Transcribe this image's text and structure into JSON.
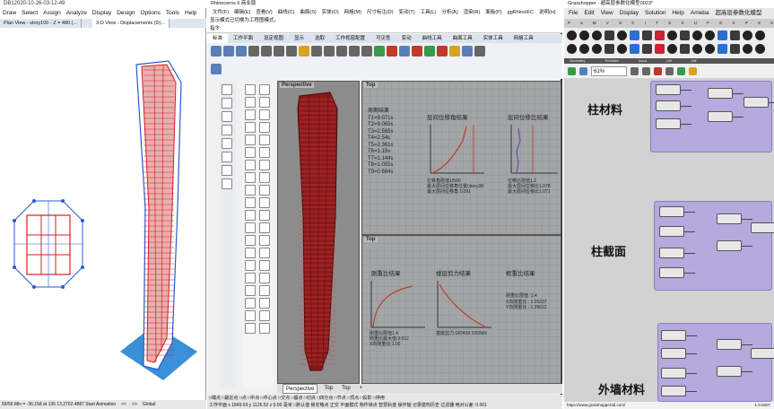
{
  "sap": {
    "title": "DB12020-10-26-03-12-49",
    "menu": [
      "Draw",
      "Select",
      "Assign",
      "Analyze",
      "Display",
      "Design",
      "Options",
      "Tools",
      "Help"
    ],
    "tab_plan": "Plan View - story100 - Z = 480 (...",
    "tab_3d": "3-D View  - Displacements (D)...",
    "status": [
      "59/56  Min = -36.158 at 136  13.2702 4887 Start Animation",
      "<<",
      ">>",
      "Global"
    ],
    "colors": {
      "frame_red": "#d62020",
      "frame_blue": "#2a5bd0",
      "base_blue": "#3a8fd6"
    }
  },
  "rhino": {
    "title": "Rhinoceros 6 商业版",
    "menu": [
      "文件(F)",
      "编辑(E)",
      "查看(V)",
      "曲线(C)",
      "曲面(S)",
      "实体(O)",
      "网格(M)",
      "尺寸标注(D)",
      "变动(T)",
      "工具(L)",
      "分析(A)",
      "渲染(R)",
      "面板(P)",
      "ggRhinoIFC",
      "说明(H)"
    ],
    "cmd_line1": "显示模式已切换为工程图模式。",
    "cmd_line2": "指令:",
    "ribbon": [
      "标准",
      "工作平面",
      "设定视图",
      "显示",
      "选取",
      "工作视窗配置",
      "可见性",
      "变动",
      "曲线工具",
      "曲面工具",
      "实体工具",
      "网格工具"
    ],
    "viewport_perspective": "Perspective",
    "viewport_top": "Top",
    "viewport_top2": "Top",
    "periods_title": "周期结果",
    "periods": [
      "T1=9.071s",
      "T2=9.065s",
      "T3=2.565s",
      "T4=2.54s",
      "T5=2.361s",
      "T6=1.15s",
      "T7=1.144s",
      "T8=1.055s",
      "T9=0.684s"
    ],
    "drift_angle_title": "层间位移角结果",
    "drift_angle_notes": [
      "位移角限值1/500",
      "最大层间位移角位置(story38",
      "最大层间位移角 1/291"
    ],
    "drift_ratio_title": "层间位移比结果",
    "drift_ratio_notes": [
      "位移比限值1.2",
      "最大层间位移比1.078",
      "最大层间位移比1.071"
    ],
    "stiffness_title": "刚重比结果",
    "stiffness_notes": [
      "刚重比限值1.4",
      "刚重比最大值:3.012",
      "X向刚重比:1.00"
    ],
    "shear_ratio_title": "楼层剪力结果",
    "shear_ratio_notes": [
      "基底剪力:182439.1003kN"
    ],
    "rigid_weight_title": "框重比结果",
    "rigid_weight_notes": [
      "刚重比限值 :1.4",
      "X向刚重比 : 1.25237",
      "Y向刚重比 : 1.35612"
    ],
    "view_tabs": [
      "Perspective",
      "Top",
      "Top",
      "+"
    ],
    "osnap": "□端点 □最近点 □点 □中点 □中心点 □交点 □垂点 □切点 □四分点 □节点 □顶点 □投影 □停用",
    "status2": "工作平面  x 1849.69  y 1125.52  z 0.00  毫米  □默认值  锁定格点  正交  平面模式  物件锁点  智慧轨迹  操作轴  记录建构历史  过滤器  绝对公差: 0.001"
  },
  "grasshopper": {
    "title": "Grasshopper - 超高层参数化模型0023*",
    "menu": [
      "File",
      "Edit",
      "View",
      "Display",
      "Solution",
      "Help",
      "Ameba",
      "超高层参数化模型"
    ],
    "tabrow": "P a M V S C I T S X U F E X P X K R E",
    "categories": [
      "Geometry",
      "Primitive",
      "Input",
      "Util",
      "Util"
    ],
    "zoom": "61%",
    "group_labels": [
      "柱材料",
      "柱截面",
      "外墙材料"
    ],
    "status": "https://www.grasshopper3d.com/",
    "version": "1.0.0007",
    "colors": {
      "group_fill": "#b6a9dd",
      "canvas": "#d2d2d2"
    }
  }
}
